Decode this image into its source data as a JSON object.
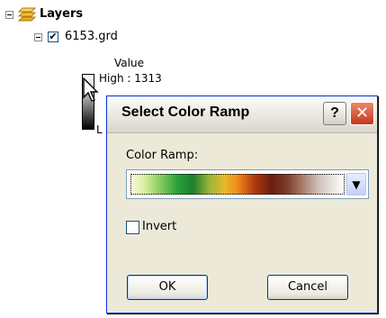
{
  "toc": {
    "root_label": "Layers",
    "layer_name": "6153.grd",
    "legend_heading": "Value",
    "legend_high": "High : 1313",
    "legend_low_partial": "L"
  },
  "dialog": {
    "title": "Select Color Ramp",
    "help_label": "?",
    "close_label": "✕",
    "color_ramp_label": "Color Ramp:",
    "invert_label": "Invert",
    "invert_checked": false,
    "ok_label": "OK",
    "cancel_label": "Cancel",
    "dropdown_glyph": "▼"
  },
  "colors": {
    "dialog_bg": "#ece9d8",
    "close_red": "#c6361f",
    "border_blue": "#003c74"
  }
}
